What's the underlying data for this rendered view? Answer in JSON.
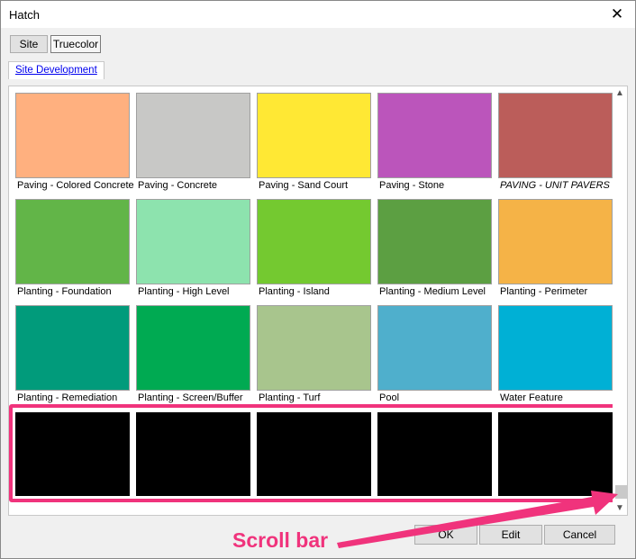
{
  "window": {
    "title": "Hatch"
  },
  "tabs": [
    {
      "label": "Site"
    },
    {
      "label": "Truecolor"
    }
  ],
  "section_link": "Site Development",
  "hatches": [
    {
      "label": "Paving - Colored Concrete",
      "color": "#ffb07f"
    },
    {
      "label": "Paving - Concrete",
      "color": "#c8c8c6"
    },
    {
      "label": "Paving - Sand Court",
      "color": "#ffe834"
    },
    {
      "label": "Paving - Stone",
      "color": "#bb55bb"
    },
    {
      "label": "PAVING - UNIT PAVERS",
      "color": "#bb5d5a"
    },
    {
      "label": "Planting - Foundation",
      "color": "#62b548"
    },
    {
      "label": "Planting - High Level",
      "color": "#8de3ae"
    },
    {
      "label": "Planting - Island",
      "color": "#74c930"
    },
    {
      "label": "Planting - Medium Level",
      "color": "#5c9f42"
    },
    {
      "label": "Planting - Perimeter",
      "color": "#f5b347"
    },
    {
      "label": "Planting - Remediation",
      "color": "#019b7b"
    },
    {
      "label": "Planting - Screen/Buffer",
      "color": "#00aa52"
    },
    {
      "label": "Planting - Turf",
      "color": "#a8c58d"
    },
    {
      "label": "Pool",
      "color": "#4fafcc"
    },
    {
      "label": "Water Feature",
      "color": "#00b0d5"
    }
  ],
  "empty_swatch_color": "#000000",
  "buttons": {
    "ok": "OK",
    "edit": "Edit",
    "cancel": "Cancel"
  },
  "annotation": {
    "text": "Scroll bar",
    "color": "#f0337c"
  }
}
